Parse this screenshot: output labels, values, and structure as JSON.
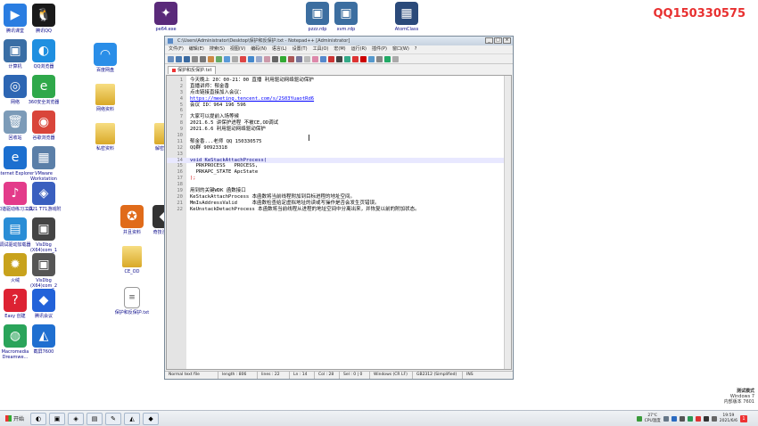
{
  "watermark": "QQ150330575",
  "system_info": {
    "line1": "测试模式",
    "line2": "Windows 7",
    "line3": "内部版本 7601"
  },
  "desktop_icons": [
    {
      "label": "腾讯课堂",
      "glyph": "▶",
      "color": "#2a7de1"
    },
    {
      "label": "腾讯QQ",
      "glyph": "🐧",
      "color": "#1a1a1a"
    },
    {
      "label": "计算机",
      "glyph": "▣",
      "color": "#3a6ea5"
    },
    {
      "label": "QQ浏览器",
      "glyph": "◐",
      "color": "#1f8fe0"
    },
    {
      "label": "网络",
      "glyph": "◎",
      "color": "#2d66b3"
    },
    {
      "label": "360安全浏览器",
      "glyph": "e",
      "color": "#2fa84a"
    },
    {
      "label": "回收站",
      "glyph": "🗑",
      "color": "#7c9bb8"
    },
    {
      "label": "谷歌浏览器",
      "glyph": "◉",
      "color": "#d9453a"
    },
    {
      "label": "Internet Explorer",
      "glyph": "e",
      "color": "#1c6fcf"
    },
    {
      "label": "VMware Workstation",
      "glyph": "▦",
      "color": "#5b7fa8"
    },
    {
      "label": "和谐驱动练习工具",
      "glyph": "♪",
      "color": "#e33b8a"
    },
    {
      "label": "2021 T71游戏附",
      "glyph": "◈",
      "color": "#3a5fbf"
    },
    {
      "label": "调试驱动加载器",
      "glyph": "▤",
      "color": "#2a8dd6"
    },
    {
      "label": "VisDbg (X64)com_1",
      "glyph": "▣",
      "color": "#444"
    },
    {
      "label": "火绒",
      "glyph": "✹",
      "color": "#c8a21c"
    },
    {
      "label": "VisDbg (X64)com_2",
      "glyph": "▣",
      "color": "#555"
    },
    {
      "label": "Easy 创建",
      "glyph": "?",
      "color": "#d23"
    },
    {
      "label": "腾讯会议",
      "glyph": "◆",
      "color": "#2262d9"
    },
    {
      "label": "Macromedia Dreamwe...",
      "glyph": "◍",
      "color": "#2aa45a"
    },
    {
      "label": "截屏7600",
      "glyph": "◭",
      "color": "#1f6fd0"
    }
  ],
  "top_icons": [
    {
      "label": "pe64.exe",
      "glyph": "✦",
      "color": "#5a2a7a"
    },
    {
      "label": "pzzz.rdp",
      "glyph": "▣",
      "color": "#3c6ea0"
    },
    {
      "label": "xvm.rdp",
      "glyph": "▣",
      "color": "#3c6ea0"
    },
    {
      "label": "AtomClass",
      "glyph": "▦",
      "color": "#2b4a7a"
    }
  ],
  "mid_icons": [
    {
      "label": "百度网盘",
      "glyph": "◠",
      "color": "#2a8ee8"
    },
    {
      "label": "网络资料",
      "glyph": "",
      "color": ""
    },
    {
      "label": "私密资料",
      "glyph": "",
      "color": ""
    },
    {
      "label": "解密文件",
      "glyph": "",
      "color": ""
    },
    {
      "label": "CE_OD",
      "glyph": "",
      "color": ""
    },
    {
      "label": "保护和反保护.txt",
      "glyph": "≡",
      "color": ""
    }
  ],
  "right_icons": [
    {
      "label": "并且资料",
      "glyph": "✪",
      "color": "#e06b1a"
    },
    {
      "label": "奇技淫巧...",
      "glyph": "◆",
      "color": "#333"
    }
  ],
  "notepad": {
    "title": "C:\\Users\\Administrator\\Desktop\\保护和反保护.txt - Notepad++ [Administrator]",
    "menu": [
      "文件(F)",
      "编辑(E)",
      "搜索(S)",
      "视图(V)",
      "编码(N)",
      "语言(L)",
      "设置(T)",
      "工具(O)",
      "宏(M)",
      "运行(R)",
      "插件(P)",
      "窗口(W)",
      "?"
    ],
    "tab": "保护和反保护.txt",
    "lines": [
      "今天晚上 20：00-21：00 直播 利用驱动网络驱动保护",
      "直播讲师：郁金香",
      "点击链接直接加入会议：",
      "https://meeting.tencent.com/s/2S03YuaotRd6",
      "会议 ID：964 196 596",
      "",
      "大家可以提前入场等候",
      "2021.6.5 讲保护进程 不被CE,OD调试",
      "2021.6.6 利用驱动网络驱动保护",
      "",
      "郁金香...老师 QQ 150330575",
      "QQ群 90923318",
      "",
      "void KeStackAttachProcess(",
      "  PRKPROCESS   PROCESS,",
      "  PRKAPC_STATE ApcState",
      ");",
      "",
      "用到的关键WDK 函数接口",
      "KeStackAttachProcess 本函数将当前线程附加到目标进程的地址空间。",
      "MmIsAddressValid     本函数检查给定虚拟地址的读或写操作是否会发生页错误。",
      "KeUnstackDetachProcess 本函数将当前线程从进程的地址空间中分离出来，并恢复以前的附加状态。"
    ],
    "status": {
      "type": "Normal text file",
      "length": "length : 806",
      "lines": "lines : 22",
      "ln": "Ln : 14",
      "col": "Col : 28",
      "sel": "Sel : 0 | 0",
      "eol": "Windows (CR LF)",
      "encoding": "GB2312 (Simplified)",
      "mode": "INS"
    }
  },
  "taskbar": {
    "start": "开始",
    "apps": [
      "◐",
      "▣",
      "◈",
      "▤",
      "✎",
      "◭",
      "◆"
    ],
    "weather_temp": "27℃",
    "weather_desc": "CPU温度",
    "time": "19:59",
    "date": "2021/6/6"
  }
}
